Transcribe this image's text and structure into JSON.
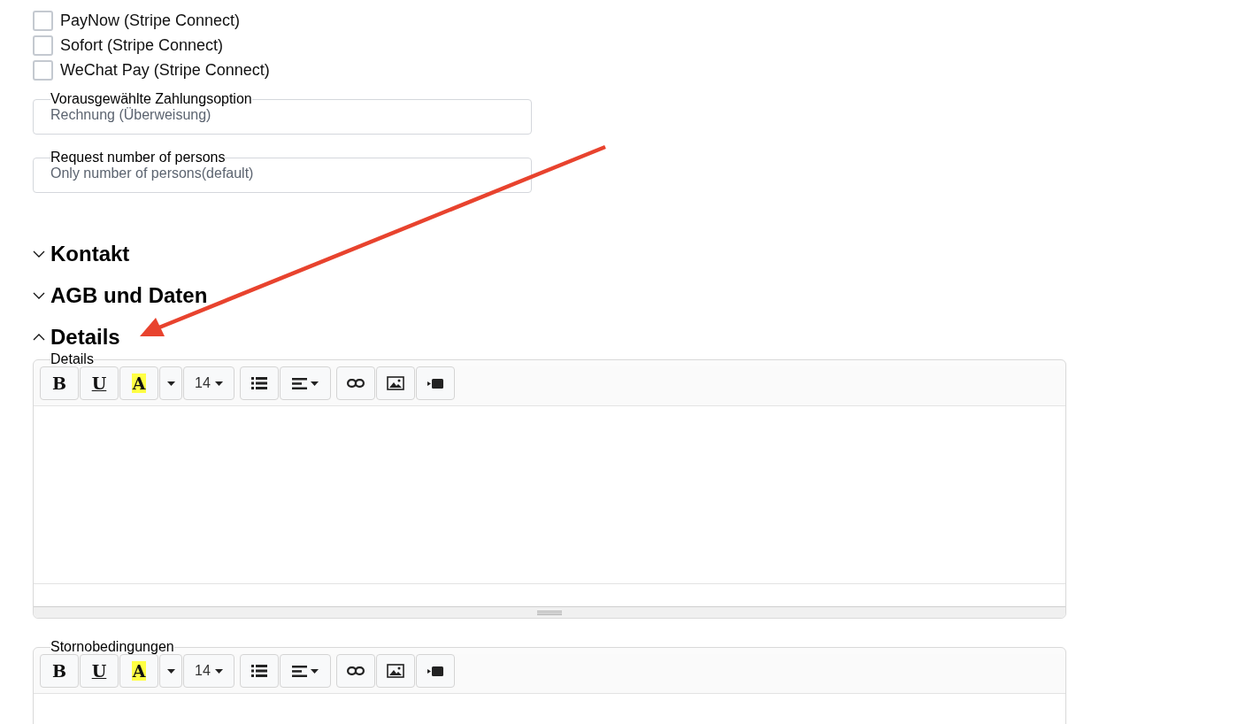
{
  "payment_methods": [
    {
      "label": "PayNow (Stripe Connect)",
      "checked": false
    },
    {
      "label": "Sofort (Stripe Connect)",
      "checked": false
    },
    {
      "label": "WeChat Pay (Stripe Connect)",
      "checked": false
    }
  ],
  "selects": [
    {
      "label": "Vorausgewählte Zahlungsoption",
      "value": "Rechnung (Überweisung)"
    },
    {
      "label": "Request number of persons",
      "value": "Only number of persons(default)"
    }
  ],
  "sections": [
    {
      "title": "Kontakt",
      "expanded": false
    },
    {
      "title": "AGB und Daten",
      "expanded": false
    },
    {
      "title": "Details",
      "expanded": true,
      "editors": [
        {
          "label": "Details",
          "bold": "B",
          "underline": "U",
          "text_color_letter": "A",
          "font_size": "14"
        },
        {
          "label": "Stornobedingungen",
          "bold": "B",
          "underline": "U",
          "text_color_letter": "A",
          "font_size": "14"
        }
      ]
    }
  ]
}
